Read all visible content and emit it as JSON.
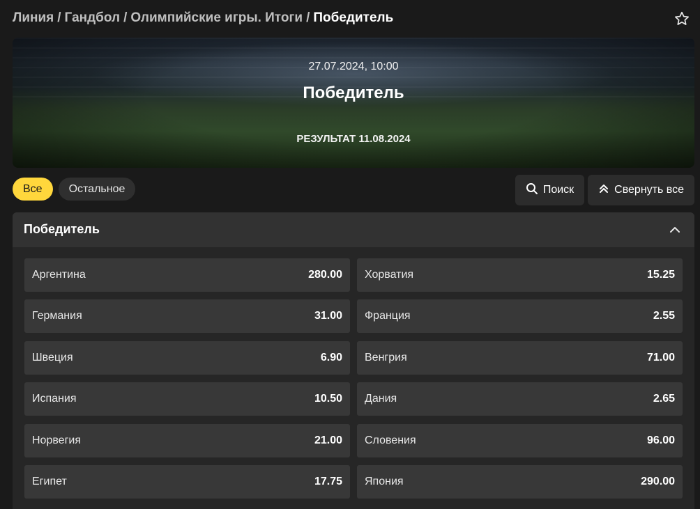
{
  "breadcrumb": {
    "items": [
      "Линия",
      "Гандбол",
      "Олимпийские игры. Итоги",
      "Победитель"
    ],
    "separator": "/"
  },
  "header": {
    "favorite_icon": "star-outline-icon"
  },
  "banner": {
    "date": "27.07.2024, 10:00",
    "title": "Победитель",
    "result": "РЕЗУЛЬТАТ 11.08.2024"
  },
  "filters": [
    {
      "label": "Все",
      "active": true
    },
    {
      "label": "Остальное",
      "active": false
    }
  ],
  "actions": {
    "search_label": "Поиск",
    "collapse_all_label": "Свернуть все"
  },
  "market": {
    "title": "Победитель",
    "outcomes": [
      {
        "name": "Аргентина",
        "odds": "280.00"
      },
      {
        "name": "Хорватия",
        "odds": "15.25"
      },
      {
        "name": "Германия",
        "odds": "31.00"
      },
      {
        "name": "Франция",
        "odds": "2.55"
      },
      {
        "name": "Швеция",
        "odds": "6.90"
      },
      {
        "name": "Венгрия",
        "odds": "71.00"
      },
      {
        "name": "Испания",
        "odds": "10.50"
      },
      {
        "name": "Дания",
        "odds": "2.65"
      },
      {
        "name": "Норвегия",
        "odds": "21.00"
      },
      {
        "name": "Словения",
        "odds": "96.00"
      },
      {
        "name": "Египет",
        "odds": "17.75"
      },
      {
        "name": "Япония",
        "odds": "290.00"
      }
    ]
  },
  "colors": {
    "accent": "#ffd73c",
    "background": "#1a1a1a",
    "cell": "#383838"
  }
}
